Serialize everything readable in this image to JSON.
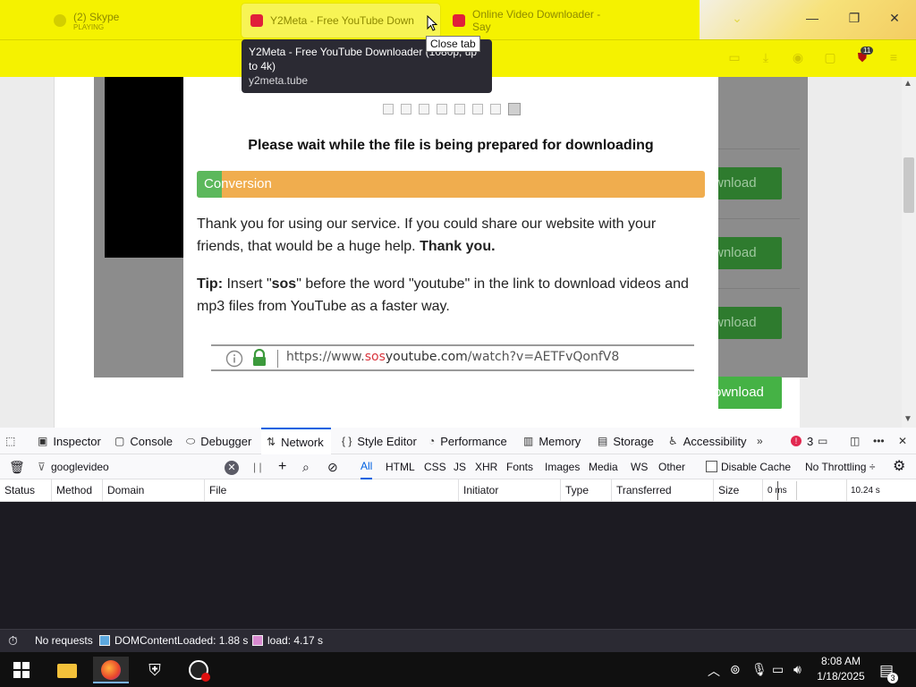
{
  "browser": {
    "tabs": [
      {
        "title": "(2) Skype",
        "subtitle": "PLAYING"
      },
      {
        "title": "Y2Meta - Free YouTube Down"
      },
      {
        "title": "Online Video Downloader - Say"
      }
    ],
    "tab_preview": {
      "title": "Y2Meta - Free YouTube Downloader (1080p, up to 4k)",
      "domain": "y2meta.tube"
    },
    "close_tooltip": "Close tab",
    "extension_badge": "11"
  },
  "page": {
    "wait_message": "Please wait while the file is being prepared for downloading",
    "progress_label": "Conversion",
    "progress_fraction": 0.05,
    "thank_you_text": "Thank you for using our service. If you could share our website with your friends, that would be a huge help.",
    "thank_you_bold": "Thank you.",
    "tip_label": "Tip:",
    "tip_text_1": " Insert \"",
    "tip_sos": "sos",
    "tip_text_2": "\" before the word \"youtube\" in the link to download videos and mp3 files from YouTube as a faster way.",
    "url_prefix": "https://www.",
    "url_sos": "sos",
    "url_domain": "youtube.com",
    "url_path": "/watch?v=AETFvQonfV8",
    "download_label": "wnload",
    "download_label_last": "ownload"
  },
  "devtools": {
    "tabs": [
      "Inspector",
      "Console",
      "Debugger",
      "Network",
      "Style Editor",
      "Performance",
      "Memory",
      "Storage",
      "Accessibility"
    ],
    "error_count": "3",
    "filter_value": "googlevideo",
    "type_filters": [
      "All",
      "HTML",
      "CSS",
      "JS",
      "XHR",
      "Fonts",
      "Images",
      "Media",
      "WS",
      "Other"
    ],
    "disable_cache": "Disable Cache",
    "throttling": "No Throttling ÷",
    "columns": [
      "Status",
      "Method",
      "Domain",
      "File",
      "Initiator",
      "Type",
      "Transferred",
      "Size"
    ],
    "timeline_start": "0 ms",
    "timeline_end": "10.24 s",
    "status": {
      "requests": "No requests",
      "dom_loaded": "DOMContentLoaded: 1.88 s",
      "load": "load: 4.17 s"
    }
  },
  "taskbar": {
    "time": "8:08 AM",
    "date": "1/18/2025",
    "notification_count": "3"
  }
}
